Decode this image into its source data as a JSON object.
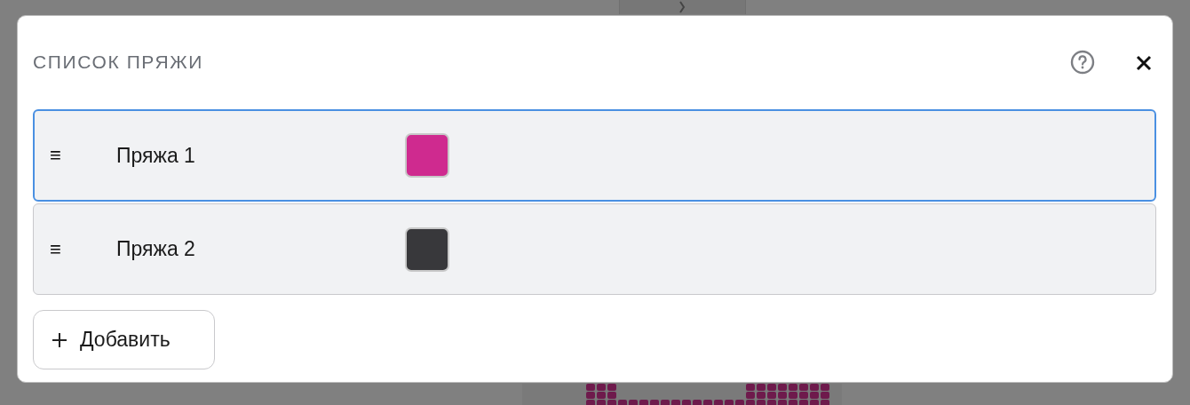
{
  "dialog": {
    "title": "СПИСОК ПРЯЖИ"
  },
  "yarns": [
    {
      "handle": "≡",
      "name": "Пряжа 1",
      "color": "#cf2a8f",
      "selected": true
    },
    {
      "handle": "≡",
      "name": "Пряжа 2",
      "color": "#38383b",
      "selected": false
    }
  ],
  "add_button": {
    "label": "Добавить"
  }
}
